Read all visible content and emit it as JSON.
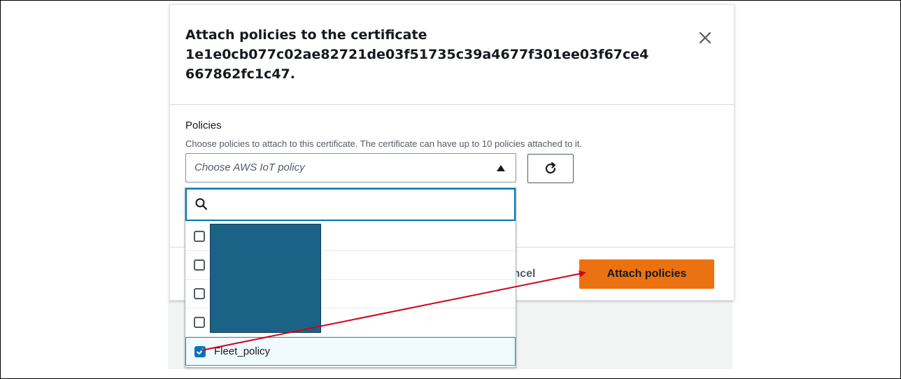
{
  "modal": {
    "title_line1": "Attach policies to the certificate",
    "title_line2": "1e1e0cb077c02ae82721de03f51735c39a4677f301ee03f67ce4",
    "title_line3": "667862fc1c47.",
    "close_icon": "close-icon"
  },
  "form": {
    "policies_label": "Policies",
    "policies_description": "Choose policies to attach to this certificate. The certificate can have up to 10 policies attached to it.",
    "select_placeholder": "Choose AWS IoT policy",
    "refresh_icon": "refresh-icon"
  },
  "dropdown": {
    "search_icon": "search-icon",
    "search_value": "",
    "options": [
      {
        "label": "",
        "checked": false
      },
      {
        "label": "",
        "checked": false
      },
      {
        "label": "",
        "checked": false
      },
      {
        "label": "",
        "checked": false
      },
      {
        "label": "Fleet_policy",
        "checked": true
      }
    ]
  },
  "footer": {
    "cancel_label": "Cancel",
    "attach_label": "Attach policies"
  },
  "colors": {
    "primary_button": "#ec7211",
    "accent_blue": "#0073bb",
    "annotation_arrow": "#d0021b",
    "redaction_box": "#1b6287"
  }
}
